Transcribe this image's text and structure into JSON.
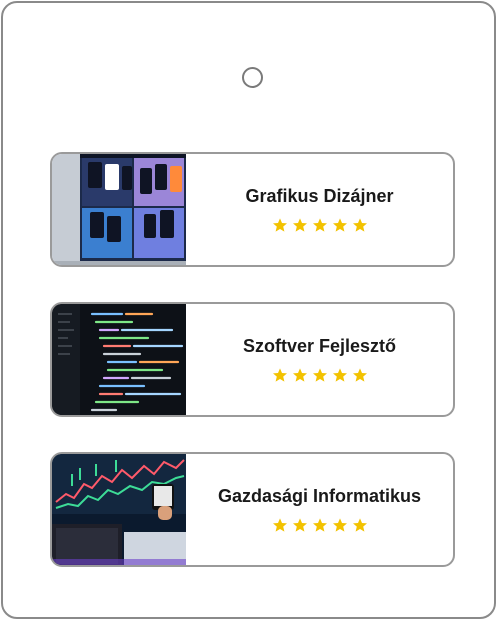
{
  "courses": [
    {
      "title": "Grafikus Dizájner",
      "thumbnail": "design-mockup-screen-image",
      "rating": 5
    },
    {
      "title": "Szoftver Fejlesztő",
      "thumbnail": "code-editor-screen-image",
      "rating": 5
    },
    {
      "title": "Gazdasági Informatikus",
      "thumbnail": "trading-charts-screen-image",
      "rating": 5
    }
  ],
  "colors": {
    "star": "#F2C200",
    "border": "#9a9a9a",
    "title": "#1a1a1a"
  }
}
